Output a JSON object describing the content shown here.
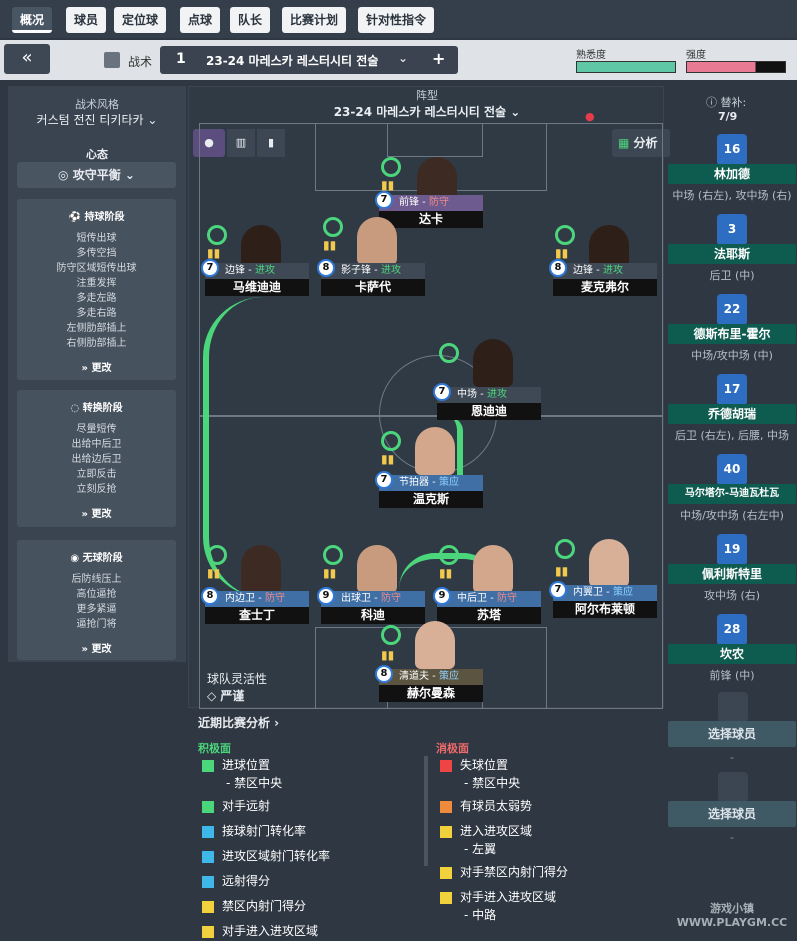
{
  "tabs": [
    "概况",
    "球员",
    "定位球",
    "点球",
    "队长",
    "比赛计划",
    "针对性指令"
  ],
  "tactic": {
    "back": "«",
    "label": "战术",
    "slot": "1",
    "name": "23-24 마레스카 레스터시티 전술",
    "plus": "+",
    "familiarity": "熟悉度",
    "intensity": "强度"
  },
  "sidebar": {
    "style_label": "战术风格",
    "style": "커스텀 전진 티키타카",
    "mentality_label": "心态",
    "mentality": "攻守平衡",
    "in_possession": {
      "title": "持球阶段",
      "items": [
        "短传出球",
        "多传空挡",
        "防守区域短传出球",
        "注重发挥",
        "多走左路",
        "多走右路",
        "左侧肋部插上",
        "右侧肋部插上"
      ],
      "more": "更改"
    },
    "transition": {
      "title": "转换阶段",
      "items": [
        "尽量短传",
        "出给中后卫",
        "出给边后卫",
        "立即反击",
        "立刻反抢"
      ],
      "more": "更改"
    },
    "out_possession": {
      "title": "无球阶段",
      "items": [
        "后防线压上",
        "高位逼抢",
        "更多紧逼",
        "逼抢门将"
      ],
      "more": "更改"
    }
  },
  "pitch": {
    "formation_label": "阵型",
    "formation": "23-24 마레스카 레스터시티 전술",
    "analysis": "分析",
    "fluidity_label": "球队灵活性",
    "fluidity": "严谨",
    "players": [
      {
        "num": "7",
        "role": "前锋",
        "duty": "防守",
        "name": "达卡"
      },
      {
        "num": "7",
        "role": "边锋",
        "duty": "进攻",
        "name": "马维迪迪"
      },
      {
        "num": "8",
        "role": "影子锋",
        "duty": "进攻",
        "name": "卡萨代"
      },
      {
        "num": "8",
        "role": "边锋",
        "duty": "进攻",
        "name": "麦克弗尔"
      },
      {
        "num": "7",
        "role": "中场",
        "duty": "进攻",
        "name": "恩迪迪"
      },
      {
        "num": "7",
        "role": "节拍器",
        "duty": "策应",
        "name": "温克斯"
      },
      {
        "num": "8",
        "role": "内边卫",
        "duty": "防守",
        "name": "查士丁"
      },
      {
        "num": "9",
        "role": "出球卫",
        "duty": "防守",
        "name": "科迪"
      },
      {
        "num": "9",
        "role": "中后卫",
        "duty": "防守",
        "name": "苏塔"
      },
      {
        "num": "7",
        "role": "内翼卫",
        "duty": "策应",
        "name": "阿尔布莱顿"
      },
      {
        "num": "8",
        "role": "清道夫",
        "duty": "策应",
        "name": "赫尔曼森"
      }
    ]
  },
  "subs": {
    "label": "替补:",
    "count": "7/9",
    "players": [
      {
        "num": "16",
        "name": "林加德",
        "pos": "中场 (右左), 攻中场 (右)"
      },
      {
        "num": "3",
        "name": "法耶斯",
        "pos": "后卫 (中)"
      },
      {
        "num": "22",
        "name": "德斯布里-霍尔",
        "pos": "中场/攻中场 (中)"
      },
      {
        "num": "17",
        "name": "乔德胡瑞",
        "pos": "后卫 (右左), 后腰, 中场"
      },
      {
        "num": "40",
        "name": "马尔塔尔-马迪瓦杜瓦",
        "pos": "中场/攻中场 (右左中)"
      },
      {
        "num": "19",
        "name": "佩利斯特里",
        "pos": "攻中场 (右)"
      },
      {
        "num": "28",
        "name": "坎农",
        "pos": "前锋 (中)"
      }
    ],
    "select": "选择球员",
    "dash": "-"
  },
  "analysis": {
    "title": "近期比赛分析 ›",
    "pos_title": "积极面",
    "neg_title": "消极面",
    "positives": [
      {
        "t": "进球位置",
        "s": "- 禁区中央"
      },
      {
        "t": "对手远射"
      },
      {
        "t": "接球射门转化率"
      },
      {
        "t": "进攻区域射门转化率"
      },
      {
        "t": "远射得分"
      },
      {
        "t": "禁区内射门得分"
      },
      {
        "t": "对手进入进攻区域"
      }
    ],
    "negatives": [
      {
        "t": "失球位置",
        "s": "- 禁区中央"
      },
      {
        "t": "有球员太弱势"
      },
      {
        "t": "进入进攻区域",
        "s": "- 左翼"
      },
      {
        "t": "对手禁区内射门得分"
      },
      {
        "t": "对手进入进攻区域",
        "s": "- 中路"
      }
    ]
  },
  "watermark": "游戏小镇 WWW.PLAYGM.CC"
}
